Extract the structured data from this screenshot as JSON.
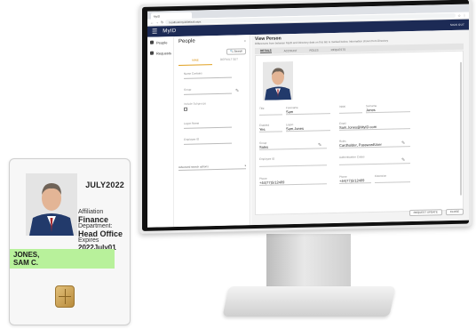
{
  "card": {
    "date": "JULY2022",
    "affiliation_label": "Affiliation",
    "affiliation": "Finance",
    "department_label": "Department:",
    "department": "Head Office",
    "expires_label": "Expires",
    "expires": "2022July01",
    "name_line1": "JONES,",
    "name_line2": "SAM C."
  },
  "browser": {
    "tab_label": "MyID",
    "url": "localhost/myid/default.aspx"
  },
  "app": {
    "menu_icon": "menu-icon",
    "title": "MyID",
    "signout": "SIGN OUT"
  },
  "leftnav": {
    "items": [
      {
        "icon": "person-icon",
        "label": "People"
      },
      {
        "icon": "requests-icon",
        "label": "Requests"
      }
    ]
  },
  "people_panel": {
    "title": "People",
    "search_button": "Search",
    "tabs": [
      "MINE",
      "DEFAULT SET"
    ],
    "fields": [
      {
        "label": "Name Contains"
      },
      {
        "label": "Group"
      },
      {
        "label": "Include Subgroups"
      },
      {
        "label": "Logon Name"
      },
      {
        "label": "Employee ID"
      }
    ],
    "dropdown": "Advanced search options"
  },
  "view_person": {
    "title": "View Person",
    "subtitle": "Differences from between MyID and Directory data on this tab is marked below. Information shown from Directory",
    "tabs": [
      "DETAILS",
      "ACCOUNT",
      "ROLES",
      "REQUESTS"
    ],
    "fields": {
      "title_label": "Title",
      "forename_label": "Forename",
      "forename": "Sam",
      "initial_label": "Initial",
      "surname_label": "Surname",
      "surname": "Jones",
      "enabled_label": "Enabled",
      "enabled": "Yes",
      "logon_label": "Logon",
      "logon": "Sam.Jones",
      "email_label": "Email",
      "email": "Sam.Jones@MyID.com",
      "group_label": "Group",
      "group": "Sales",
      "roles_label": "Roles",
      "roles": "Cardholder, PasswordUser",
      "employee_label": "Employee ID",
      "employee": "",
      "auth_label": "Authentication Codes",
      "auth": "",
      "phone_label": "Phone",
      "phone": "+44(77)5/12409",
      "mobile_label": "Phone",
      "mobile": "+44(77)5/12409",
      "extension_label": "Extension"
    },
    "footer_buttons": [
      "REQUEST UPDATE",
      "CLOSE"
    ]
  }
}
